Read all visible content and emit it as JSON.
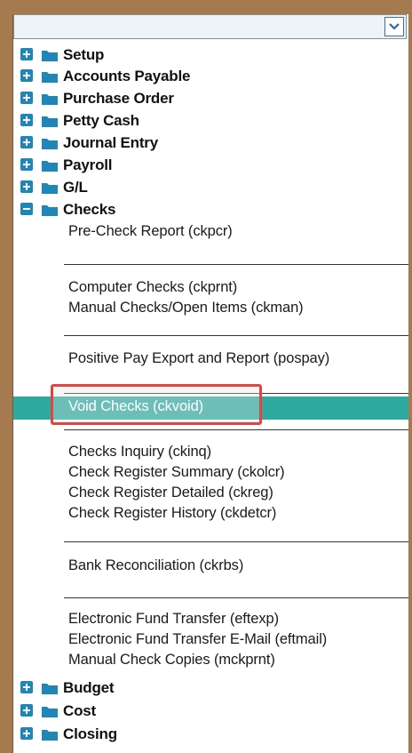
{
  "dropdown": {
    "value": ""
  },
  "top_groups": [
    {
      "label": "Setup"
    },
    {
      "label": "Accounts Payable"
    },
    {
      "label": "Purchase Order"
    },
    {
      "label": "Petty Cash"
    },
    {
      "label": "Journal Entry"
    },
    {
      "label": "Payroll"
    },
    {
      "label": "G/L"
    },
    {
      "label": "Checks",
      "expanded": true
    }
  ],
  "checks_items": [
    "Pre-Check Report (ckpcr)",
    "Computer Checks (ckprnt)",
    "Manual Checks/Open Items (ckman)",
    "Positive Pay Export and Report (pospay)",
    "Void Checks (ckvoid)",
    "Checks Inquiry (ckinq)",
    "Check Register Summary (ckolcr)",
    "Check Register Detailed (ckreg)",
    "Check Register History (ckdetcr)",
    "Bank Reconciliation (ckrbs)",
    "Electronic Fund Transfer (eftexp)",
    "Electronic Fund Transfer E-Mail (eftmail)",
    "Manual Check Copies (mckprnt)"
  ],
  "bottom_groups": [
    {
      "label": "Budget"
    },
    {
      "label": "Cost"
    },
    {
      "label": "Closing"
    }
  ],
  "selected_item": "Void Checks (ckvoid)",
  "colors": {
    "selection": "#2eaaa0",
    "highlight": "#e0463f",
    "expander": "#1e86b9",
    "folder": "#1e86b9"
  }
}
